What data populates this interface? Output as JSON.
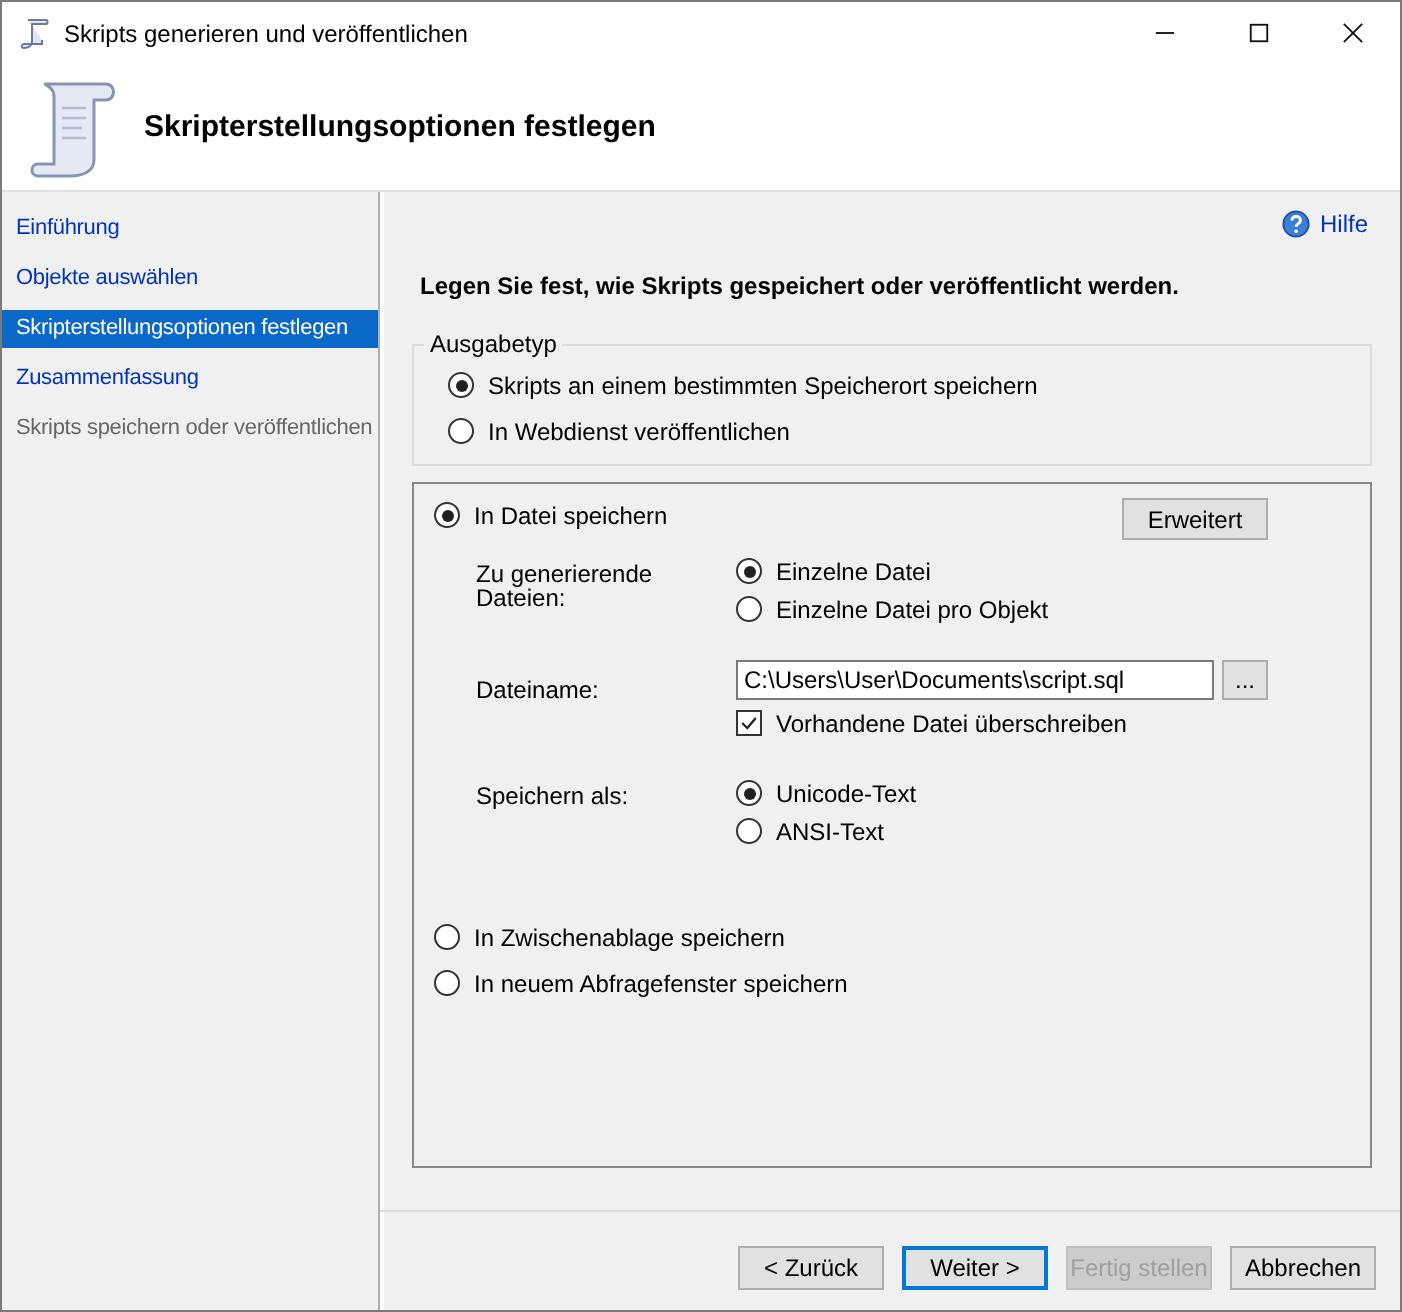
{
  "window": {
    "title": "Skripts generieren und veröffentlichen"
  },
  "header": {
    "title": "Skripterstellungsoptionen festlegen"
  },
  "nav": [
    {
      "label": "Einführung",
      "selected": false,
      "disabled": false
    },
    {
      "label": "Objekte auswählen",
      "selected": false,
      "disabled": false
    },
    {
      "label": "Skripterstellungsoptionen festlegen",
      "selected": true,
      "disabled": false
    },
    {
      "label": "Zusammenfassung",
      "selected": false,
      "disabled": false
    },
    {
      "label": "Skripts speichern oder veröffentlichen",
      "selected": false,
      "disabled": true
    }
  ],
  "help": "Hilfe",
  "instruction": "Legen Sie fest, wie Skripts gespeichert oder veröffentlicht werden.",
  "output_type": {
    "legend": "Ausgabetyp",
    "options": [
      {
        "label": "Skripts an einem bestimmten Speicherort speichern",
        "selected": true
      },
      {
        "label": "In Webdienst veröffentlichen",
        "selected": false
      }
    ]
  },
  "targets": [
    {
      "label": "In Datei speichern",
      "selected": true
    },
    {
      "label": "In Zwischenablage speichern",
      "selected": false
    },
    {
      "label": "In neuem Abfragefenster speichern",
      "selected": false
    }
  ],
  "advanced_button": "Erweitert",
  "file_settings": {
    "files_label": "Zu generierende Dateien:",
    "file_options": [
      {
        "label": "Einzelne Datei",
        "selected": true
      },
      {
        "label": "Einzelne Datei pro Objekt",
        "selected": false
      }
    ],
    "filename_label": "Dateiname:",
    "filename": "C:\\Users\\User\\Documents\\script.sql",
    "browse_button": "...",
    "overwrite": {
      "label": "Vorhandene Datei überschreiben",
      "checked": true
    },
    "save_as_label": "Speichern als:",
    "encoding_options": [
      {
        "label": "Unicode-Text",
        "selected": true
      },
      {
        "label": "ANSI-Text",
        "selected": false
      }
    ]
  },
  "buttons": [
    {
      "label": "< Zurück",
      "disabled": false,
      "default": false
    },
    {
      "label": "Weiter >",
      "disabled": false,
      "default": true
    },
    {
      "label": "Fertig stellen",
      "disabled": true,
      "default": false
    },
    {
      "label": "Abbrechen",
      "disabled": false,
      "default": false
    }
  ]
}
